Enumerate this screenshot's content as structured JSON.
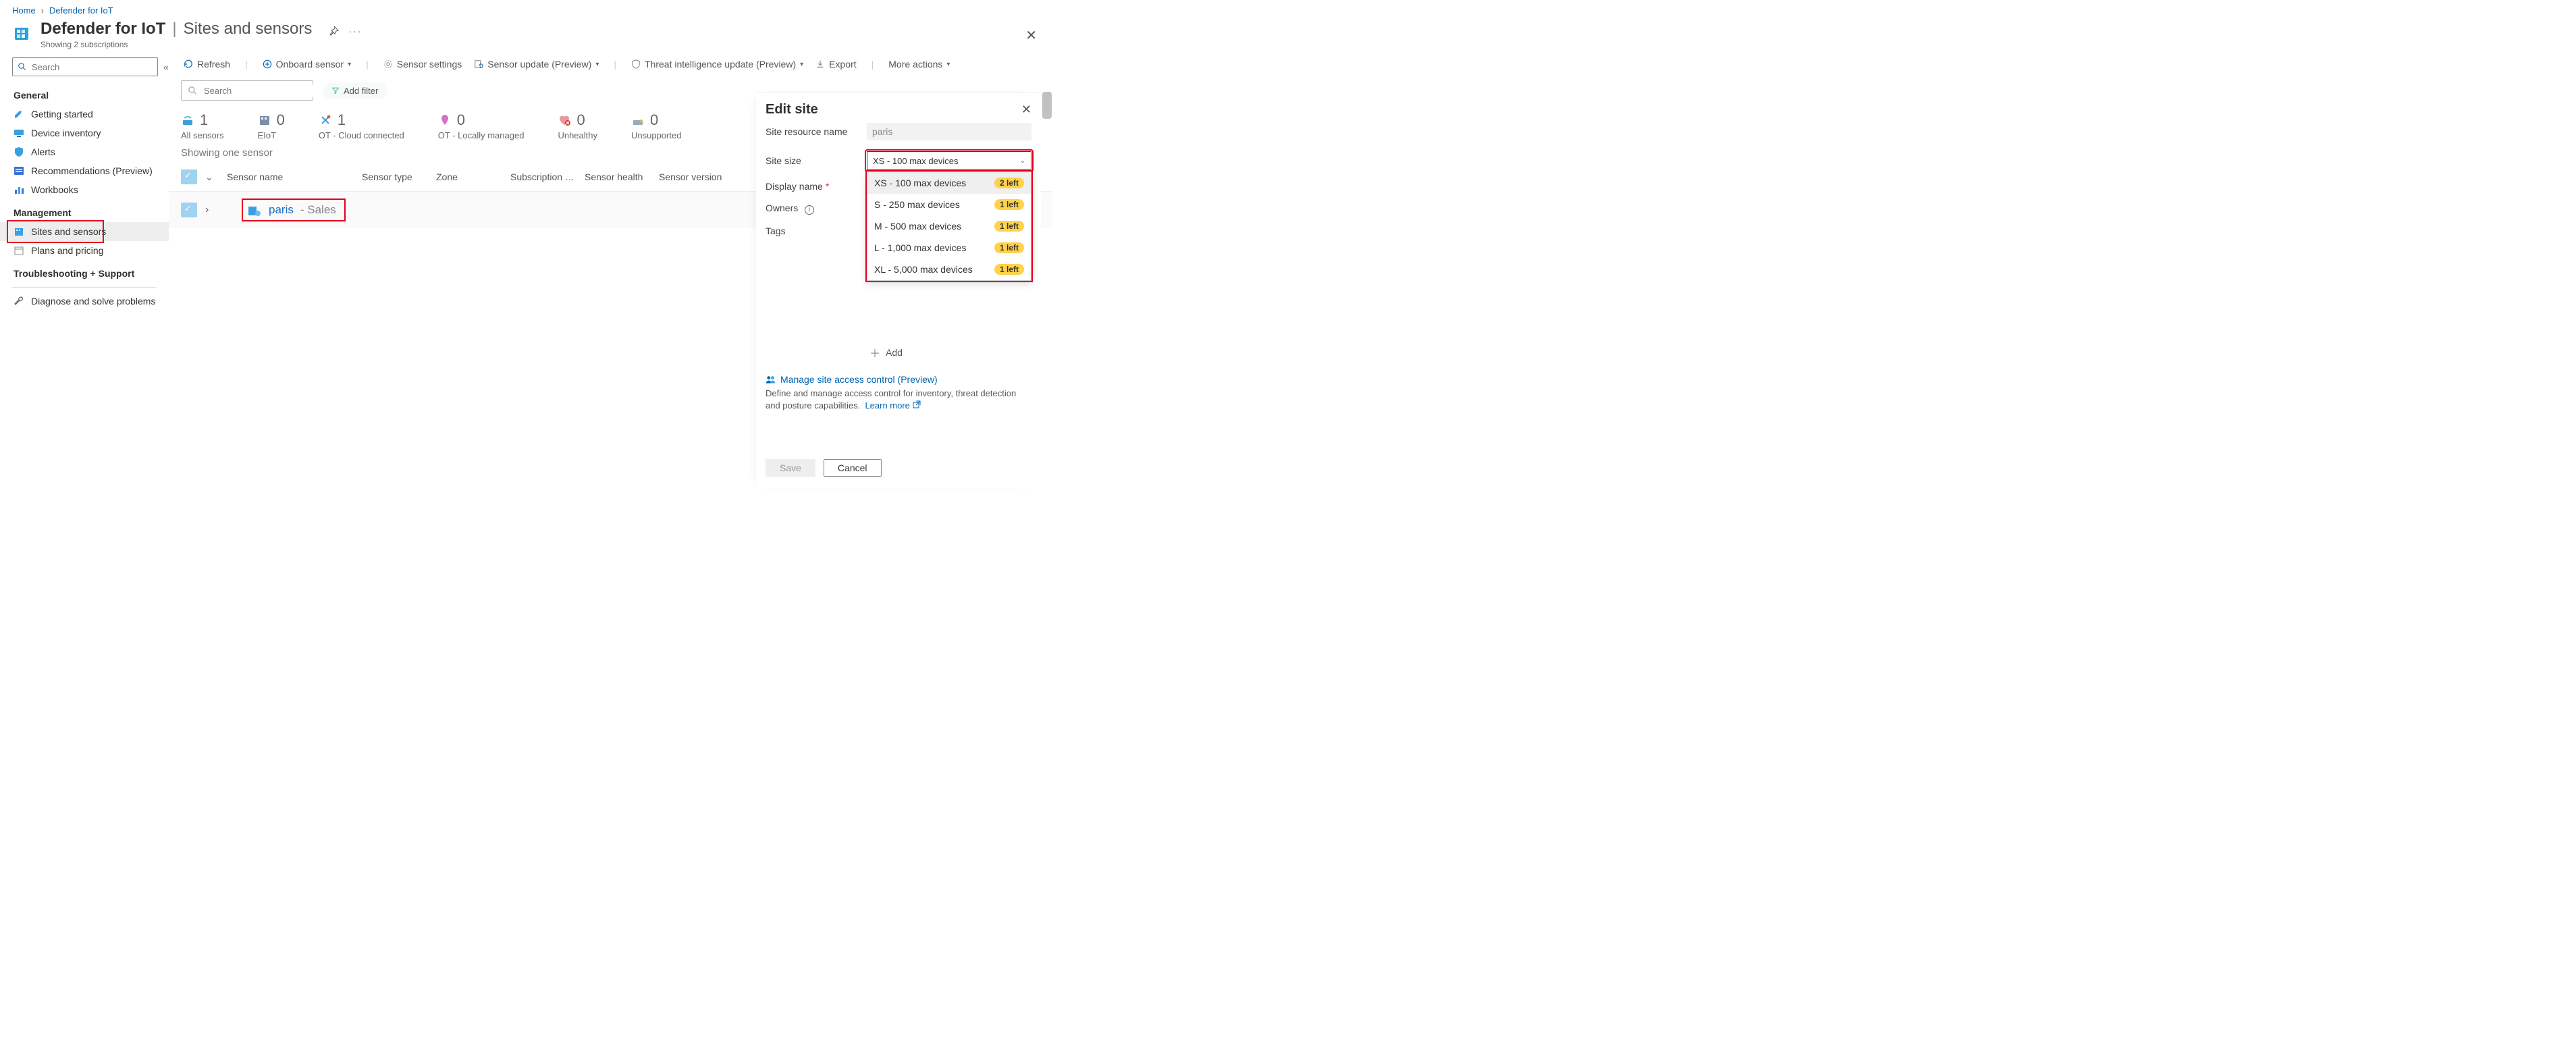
{
  "breadcrumb": {
    "home": "Home",
    "current": "Defender for IoT"
  },
  "title": {
    "main": "Defender for IoT",
    "section": "Sites and sensors",
    "subtext": "Showing 2 subscriptions"
  },
  "sidebar": {
    "search_placeholder": "Search",
    "groups": {
      "general": "General",
      "management": "Management",
      "troubleshoot": "Troubleshooting + Support"
    },
    "items": {
      "getting_started": "Getting started",
      "device_inventory": "Device inventory",
      "alerts": "Alerts",
      "recommendations": "Recommendations (Preview)",
      "workbooks": "Workbooks",
      "sites_sensors": "Sites and sensors",
      "plans_pricing": "Plans and pricing",
      "diagnose": "Diagnose and solve problems"
    }
  },
  "toolbar": {
    "refresh": "Refresh",
    "onboard": "Onboard sensor",
    "sensor_settings": "Sensor settings",
    "sensor_update": "Sensor update (Preview)",
    "ti_update": "Threat intelligence update (Preview)",
    "export": "Export",
    "more": "More actions"
  },
  "filter": {
    "search_placeholder": "Search",
    "add_filter": "Add filter"
  },
  "stats": {
    "all": {
      "value": "1",
      "label": "All sensors"
    },
    "eiot": {
      "value": "0",
      "label": "EIoT"
    },
    "ot_cloud": {
      "value": "1",
      "label": "OT - Cloud connected"
    },
    "ot_local": {
      "value": "0",
      "label": "OT - Locally managed"
    },
    "unhealthy": {
      "value": "0",
      "label": "Unhealthy"
    },
    "unsupported": {
      "value": "0",
      "label": "Unsupported"
    }
  },
  "showing_text": "Showing one sensor",
  "columns": {
    "name": "Sensor name",
    "type": "Sensor type",
    "zone": "Zone",
    "sub": "Subscription …",
    "health": "Sensor health",
    "version": "Sensor version"
  },
  "row": {
    "name": "paris",
    "subname": " - Sales"
  },
  "panel": {
    "title": "Edit site",
    "labels": {
      "resource": "Site resource name",
      "size": "Site size",
      "display": "Display name",
      "owners": "Owners",
      "tags": "Tags",
      "add": "Add"
    },
    "resource_value": "paris",
    "size_selected": "XS - 100 max devices",
    "options": [
      {
        "label": "XS - 100 max devices",
        "badge": "2 left"
      },
      {
        "label": "S - 250 max devices",
        "badge": "1 left"
      },
      {
        "label": "M - 500 max devices",
        "badge": "1 left"
      },
      {
        "label": "L - 1,000 max devices",
        "badge": "1 left"
      },
      {
        "label": "XL - 5,000 max devices",
        "badge": "1 left"
      }
    ],
    "access_link": "Manage site access control (Preview)",
    "access_desc": "Define and manage access control for inventory, threat detection and posture capabilities.",
    "learn": "Learn more",
    "save": "Save",
    "cancel": "Cancel"
  }
}
